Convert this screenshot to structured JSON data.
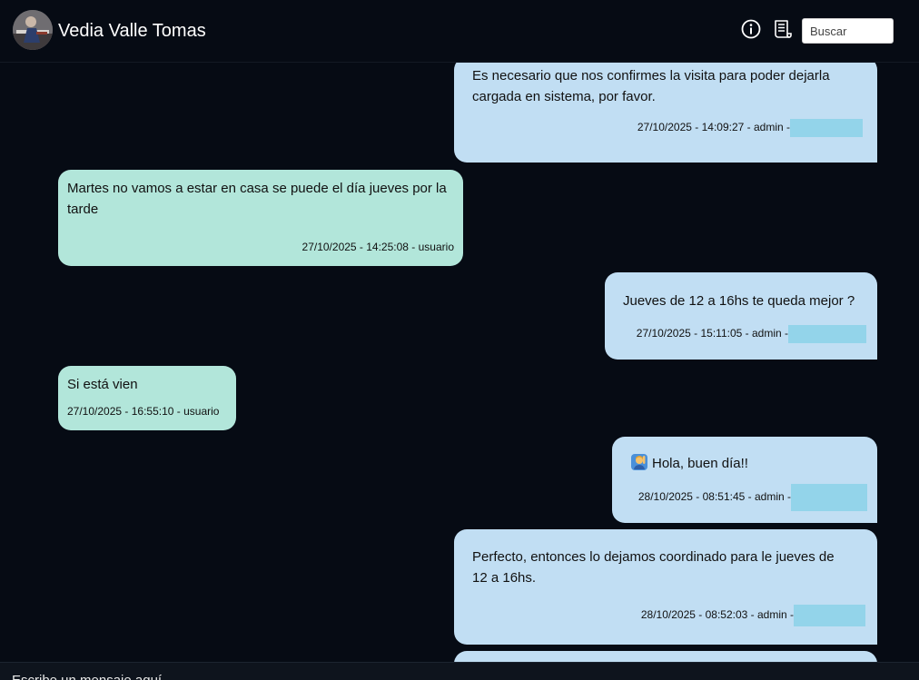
{
  "header": {
    "contact_name": "Vedia Valle Tomas",
    "avatar_icon": "user-photo-avatar",
    "info_icon": "info-circle-icon",
    "notes_icon": "receipt-icon",
    "search_placeholder": "Buscar",
    "search_value": ""
  },
  "messages": [
    {
      "direction": "out",
      "lines": [
        "Es necesario que nos confirmes la visita para poder dejarla",
        "cargada en sistema, por favor."
      ],
      "meta": "27/10/2025 - 14:09:27 - admin -",
      "redacted": true
    },
    {
      "direction": "in",
      "lines": [
        "Martes no vamos a estar en casa se puede el día jueves por la",
        "tarde"
      ],
      "meta": "27/10/2025 - 14:25:08 - usuario"
    },
    {
      "direction": "out",
      "lines": [
        "Jueves de 12 a 16hs te queda mejor ?"
      ],
      "meta": "27/10/2025 - 15:11:05 - admin -",
      "redacted": true
    },
    {
      "direction": "in",
      "lines": [
        "Si está vien"
      ],
      "meta": "27/10/2025 - 16:55:10 - usuario"
    },
    {
      "direction": "out",
      "emoji": "person-raising-hand-emoji",
      "lines": [
        "Hola, buen día!!"
      ],
      "meta": "28/10/2025 - 08:51:45 - admin -",
      "redacted": true
    },
    {
      "direction": "out",
      "lines": [
        "Perfecto, entonces lo dejamos coordinado para le jueves de",
        "12 a 16hs."
      ],
      "meta": "28/10/2025 - 08:52:03 - admin -",
      "redacted": true
    }
  ],
  "composer": {
    "placeholder": "Escribe un mensaje aquí...",
    "value": ""
  },
  "colors": {
    "background": "#060b14",
    "incoming_bubble": "#b2e6da",
    "outgoing_bubble": "#c1def3",
    "redaction": "#93d4ea"
  }
}
